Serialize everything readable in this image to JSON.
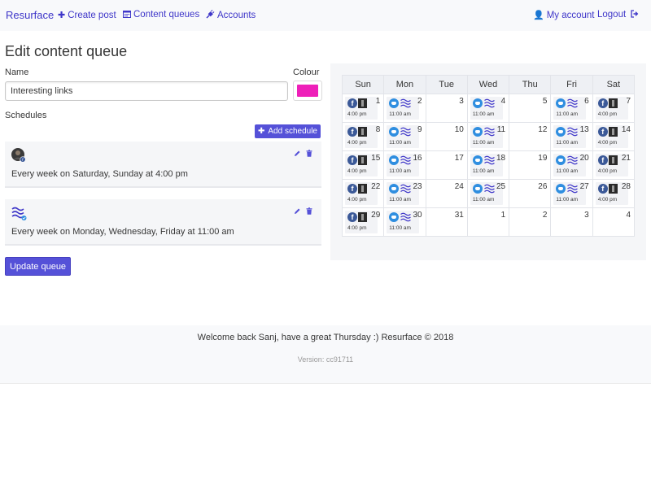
{
  "navbar": {
    "brand": "Resurface",
    "create_post": "Create post",
    "content_queues": "Content queues",
    "accounts": "Accounts",
    "my_account": "My account",
    "logout": "Logout"
  },
  "page": {
    "title": "Edit content queue",
    "name_label": "Name",
    "name_value": "Interesting links",
    "colour_label": "Colour",
    "colour_value": "#ee1fb9",
    "schedules_label": "Schedules",
    "add_schedule": "Add schedule",
    "update_button": "Update queue"
  },
  "schedules": [
    {
      "text": "Every week on Saturday, Sunday at 4:00 pm",
      "icon": "facebook-profile-avatar-icon"
    },
    {
      "text": "Every week on Monday, Wednesday, Friday at 11:00 am",
      "icon": "waves-icon"
    }
  ],
  "calendar": {
    "headers": [
      "Sun",
      "Mon",
      "Tue",
      "Wed",
      "Thu",
      "Fri",
      "Sat"
    ],
    "weeks": [
      [
        {
          "day": "1",
          "event": "fb",
          "time": "4:00 pm"
        },
        {
          "day": "2",
          "event": "tw",
          "time": "11:00 am"
        },
        {
          "day": "3",
          "event": "",
          "time": ""
        },
        {
          "day": "4",
          "event": "tw",
          "time": "11:00 am"
        },
        {
          "day": "5",
          "event": "",
          "time": ""
        },
        {
          "day": "6",
          "event": "tw",
          "time": "11:00 am"
        },
        {
          "day": "7",
          "event": "fb",
          "time": "4:00 pm"
        }
      ],
      [
        {
          "day": "8",
          "event": "fb",
          "time": "4:00 pm"
        },
        {
          "day": "9",
          "event": "tw",
          "time": "11:00 am"
        },
        {
          "day": "10",
          "event": "",
          "time": ""
        },
        {
          "day": "11",
          "event": "tw",
          "time": "11:00 am"
        },
        {
          "day": "12",
          "event": "",
          "time": ""
        },
        {
          "day": "13",
          "event": "tw",
          "time": "11:00 am"
        },
        {
          "day": "14",
          "event": "fb",
          "time": "4:00 pm"
        }
      ],
      [
        {
          "day": "15",
          "event": "fb",
          "time": "4:00 pm"
        },
        {
          "day": "16",
          "event": "tw",
          "time": "11:00 am"
        },
        {
          "day": "17",
          "event": "",
          "time": ""
        },
        {
          "day": "18",
          "event": "tw",
          "time": "11:00 am"
        },
        {
          "day": "19",
          "event": "",
          "time": ""
        },
        {
          "day": "20",
          "event": "tw",
          "time": "11:00 am"
        },
        {
          "day": "21",
          "event": "fb",
          "time": "4:00 pm"
        }
      ],
      [
        {
          "day": "22",
          "event": "fb",
          "time": "4:00 pm"
        },
        {
          "day": "23",
          "event": "tw",
          "time": "11:00 am"
        },
        {
          "day": "24",
          "event": "",
          "time": ""
        },
        {
          "day": "25",
          "event": "tw",
          "time": "11:00 am"
        },
        {
          "day": "26",
          "event": "",
          "time": ""
        },
        {
          "day": "27",
          "event": "tw",
          "time": "11:00 am"
        },
        {
          "day": "28",
          "event": "fb",
          "time": "4:00 pm"
        }
      ],
      [
        {
          "day": "29",
          "event": "fb",
          "time": "4:00 pm"
        },
        {
          "day": "30",
          "event": "tw",
          "time": "11:00 am"
        },
        {
          "day": "31",
          "event": "",
          "time": ""
        },
        {
          "day": "1",
          "event": "",
          "time": ""
        },
        {
          "day": "2",
          "event": "",
          "time": ""
        },
        {
          "day": "3",
          "event": "",
          "time": ""
        },
        {
          "day": "4",
          "event": "",
          "time": ""
        }
      ]
    ]
  },
  "footer": {
    "welcome": "Welcome back Sanj, have a great Thursday :) Resurface © 2018",
    "version": "Version: cc91711"
  },
  "colors": {
    "accent": "#3f37c9",
    "button": "#5551d8",
    "facebook": "#3b5998",
    "twitter": "#2f8ee0"
  }
}
